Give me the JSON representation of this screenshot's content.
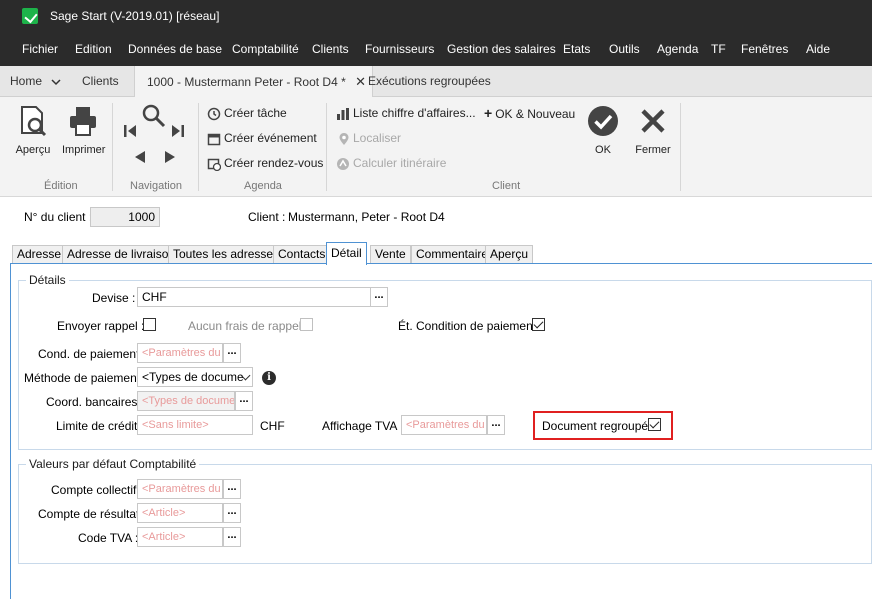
{
  "window": {
    "title": "Sage Start (V-2019.01) [réseau]"
  },
  "menu": [
    "Fichier",
    "Edition",
    "Données de base",
    "Comptabilité",
    "Clients",
    "Fournisseurs",
    "Gestion des salaires",
    "Etats",
    "Outils",
    "Agenda",
    "TF",
    "Fenêtres",
    "Aide"
  ],
  "doc_tabs": {
    "home": "Home",
    "clients": "Clients",
    "active": "1000 - Mustermann Peter - Root D4 *",
    "executions": "Exécutions regroupées"
  },
  "ribbon": {
    "edition": {
      "label": "Édition",
      "apercu": "Aperçu",
      "imprimer": "Imprimer"
    },
    "navigation": {
      "label": "Navigation"
    },
    "agenda": {
      "label": "Agenda",
      "creer_tache": "Créer tâche",
      "creer_evenement": "Créer événement",
      "creer_rdv": "Créer rendez-vous"
    },
    "client": {
      "label": "Client",
      "liste_ca": "Liste chiffre d'affaires...",
      "ok_nouveau": "OK & Nouveau",
      "localiser": "Localiser",
      "calculer": "Calculer itinéraire",
      "ok": "OK",
      "fermer": "Fermer"
    }
  },
  "client_strip": {
    "no_label": "N° du client :",
    "no_value": "1000",
    "client_label": "Client :",
    "client_value": "Mustermann, Peter - Root D4"
  },
  "detail_tabs": [
    "Adresse",
    "Adresse de livraison",
    "Toutes les adresses",
    "Contacts",
    "Détail",
    "Vente",
    "Commentaire",
    "Aperçu"
  ],
  "details": {
    "title": "Détails",
    "devise_label": "Devise :",
    "devise_value": "CHF",
    "envoyer_rappel_label": "Envoyer rappel :",
    "aucun_frais_label": "Aucun frais de rappel :",
    "et_condition_label": "Ét. Condition de paiement :",
    "cond_paiement_label": "Cond. de paiement :",
    "cond_paiement_ph": "<Paramètres du d",
    "methode_label": "Méthode de paiement :",
    "methode_value": "<Types de docume",
    "coord_label": "Coord. bancaires :",
    "coord_ph": "<Types de docume",
    "limite_label": "Limite de crédit :",
    "limite_ph": "<Sans limite>",
    "limite_unit": "CHF",
    "affichage_tva_label": "Affichage TVA :",
    "affichage_tva_ph": "<Paramètres du d",
    "doc_regroupe_label": "Document regroupé :"
  },
  "checkboxes": {
    "envoyer_rappel": false,
    "aucun_frais": false,
    "et_condition": true,
    "doc_regroupe": true
  },
  "compta": {
    "title": "Valeurs par défaut Comptabilité",
    "compte_collectif_label": "Compte collectif :",
    "compte_collectif_ph": "<Paramètres du d",
    "compte_resultat_label": "Compte de résultat :",
    "compte_resultat_ph": "<Article>",
    "code_tva_label": "Code TVA :",
    "code_tva_ph": "<Article>"
  },
  "colors": {
    "accent": "#4f92d3",
    "highlight": "#e02020",
    "titlebar": "#2b2b2b",
    "logo": "#1db34a",
    "placeholder": "#e89a9a"
  }
}
